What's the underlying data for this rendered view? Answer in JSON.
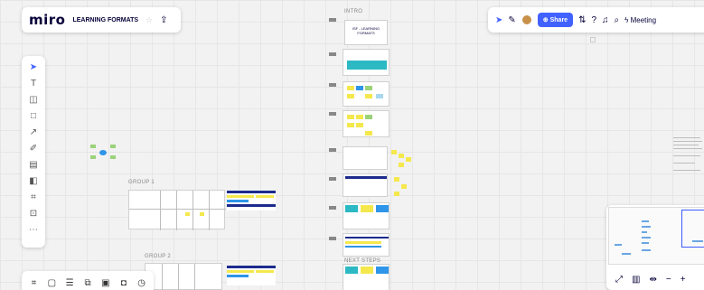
{
  "app": {
    "logo": "miro",
    "board_name": "LEARNING FORMATS",
    "star_icon": "star-icon",
    "upload_icon": "upload-icon"
  },
  "topbar_right": {
    "share_label": "Share",
    "meeting_label": "Meeting",
    "icons": [
      "cursor-icon",
      "no-cursor-icon",
      "avatar",
      "share-icon",
      "emoji-reactions-icon",
      "help-icon",
      "bell-icon",
      "search-icon",
      "lightning-icon"
    ]
  },
  "board": {
    "intro_label": "INTRO",
    "group1_label": "GROUP 1",
    "group2_label": "GROUP 2",
    "cover_title": "ISF - LEARNING FORMATS",
    "next_steps_label": "NEXT STEPS"
  },
  "left_toolbar": {
    "tools": [
      "select-icon",
      "text-icon",
      "sticky-note-icon",
      "shape-icon",
      "arrow-icon",
      "pen-icon",
      "comment-icon",
      "frame-icon",
      "crop-icon",
      "upload-icon",
      "more-icon"
    ]
  },
  "bottom_toolbar": {
    "tools": [
      "grid-icon",
      "comments-icon",
      "list-icon",
      "share-screen-icon",
      "present-icon",
      "video-icon",
      "timer-icon"
    ]
  },
  "zoom": {
    "icons": [
      "fit-icon",
      "map-icon",
      "fit-width-icon",
      "zoom-out-icon",
      "zoom-in-icon"
    ]
  },
  "colors": {
    "accent": "#4262ff",
    "canvas": "#f2f2f2",
    "sticky_yellow": "#f5e84d",
    "sticky_blue": "#2f95e8"
  }
}
